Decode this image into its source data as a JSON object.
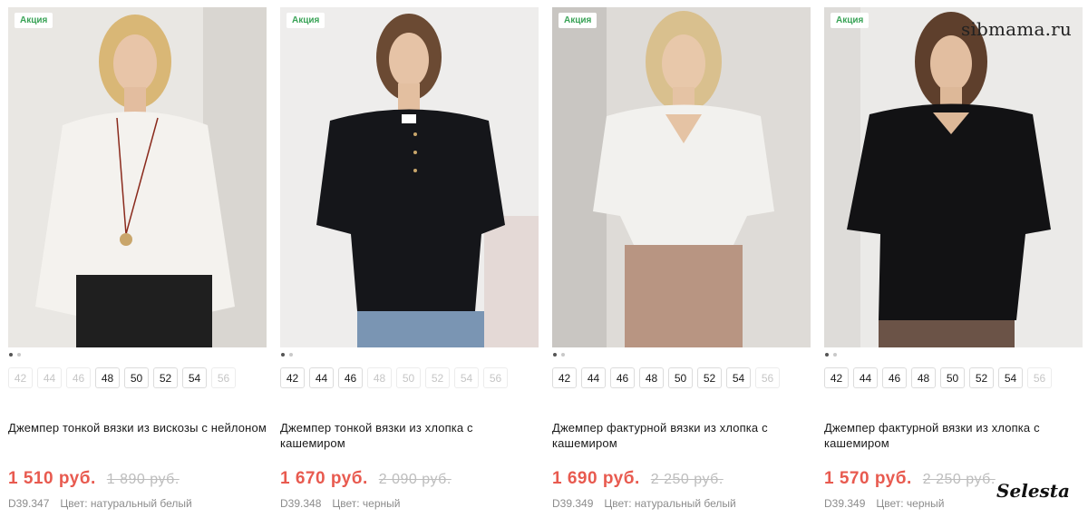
{
  "products": [
    {
      "badge": "Акция",
      "sizes": [
        {
          "label": "42",
          "available": false
        },
        {
          "label": "44",
          "available": false
        },
        {
          "label": "46",
          "available": false
        },
        {
          "label": "48",
          "available": true
        },
        {
          "label": "50",
          "available": true
        },
        {
          "label": "52",
          "available": true
        },
        {
          "label": "54",
          "available": true
        },
        {
          "label": "56",
          "available": false
        }
      ],
      "title": "Джемпер тонкой вязки из вискозы с нейлоном",
      "price": "1 510 руб.",
      "old_price": "1 890 руб.",
      "sku": "D39.347",
      "color": "Цвет: натуральный белый",
      "garment_color": "#f4f2ee",
      "photo_bg": "#e9e7e3"
    },
    {
      "badge": "Акция",
      "sizes": [
        {
          "label": "42",
          "available": true
        },
        {
          "label": "44",
          "available": true
        },
        {
          "label": "46",
          "available": true
        },
        {
          "label": "48",
          "available": false
        },
        {
          "label": "50",
          "available": false
        },
        {
          "label": "52",
          "available": false
        },
        {
          "label": "54",
          "available": false
        },
        {
          "label": "56",
          "available": false
        }
      ],
      "title": "Джемпер тонкой вязки из хлопка с кашемиром",
      "price": "1 670 руб.",
      "old_price": "2 090 руб.",
      "sku": "D39.348",
      "color": "Цвет: черный",
      "garment_color": "#15161a",
      "photo_bg": "#eeedec"
    },
    {
      "badge": "Акция",
      "sizes": [
        {
          "label": "42",
          "available": true
        },
        {
          "label": "44",
          "available": true
        },
        {
          "label": "46",
          "available": true
        },
        {
          "label": "48",
          "available": true
        },
        {
          "label": "50",
          "available": true
        },
        {
          "label": "52",
          "available": true
        },
        {
          "label": "54",
          "available": true
        },
        {
          "label": "56",
          "available": false
        }
      ],
      "title": "Джемпер фактурной вязки из хлопка с кашемиром",
      "price": "1 690 руб.",
      "old_price": "2 250 руб.",
      "sku": "D39.349",
      "color": "Цвет: натуральный белый",
      "garment_color": "#f2f1ee",
      "photo_bg": "#dedbd7"
    },
    {
      "badge": "Акция",
      "sizes": [
        {
          "label": "42",
          "available": true
        },
        {
          "label": "44",
          "available": true
        },
        {
          "label": "46",
          "available": true
        },
        {
          "label": "48",
          "available": true
        },
        {
          "label": "50",
          "available": true
        },
        {
          "label": "52",
          "available": true
        },
        {
          "label": "54",
          "available": true
        },
        {
          "label": "56",
          "available": false
        }
      ],
      "title": "Джемпер фактурной вязки из хлопка с кашемиром",
      "price": "1 570 руб.",
      "old_price": "2 250 руб.",
      "sku": "D39.349",
      "color": "Цвет: черный",
      "garment_color": "#121214",
      "photo_bg": "#ebeae8"
    }
  ],
  "watermark": {
    "site": "sibmama.ru",
    "brand": "Selesta"
  },
  "colors": {
    "price": "#e85a4f",
    "badge_text": "#3aa357"
  }
}
